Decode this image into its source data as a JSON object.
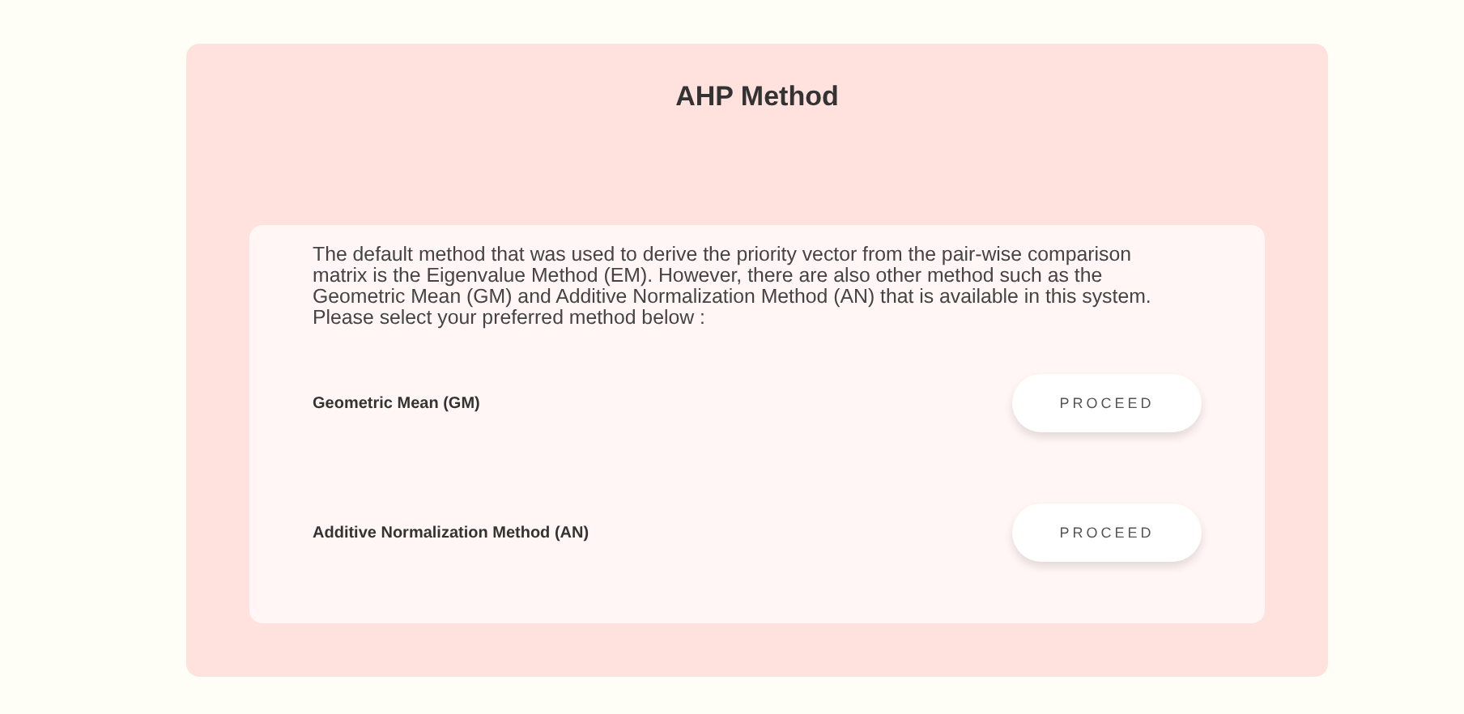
{
  "title": "AHP Method",
  "description": "The default method that was used to derive the priority vector from the pair-wise comparison matrix is the Eigenvalue Method (EM). However, there are also other method such as the Geometric Mean (GM) and Additive Normalization Method (AN) that is available in this system. Please select your preferred method below :",
  "methods": [
    {
      "label": "Geometric Mean (GM)",
      "button": "PROCEED"
    },
    {
      "label": "Additive Normalization Method (AN)",
      "button": "PROCEED"
    }
  ]
}
